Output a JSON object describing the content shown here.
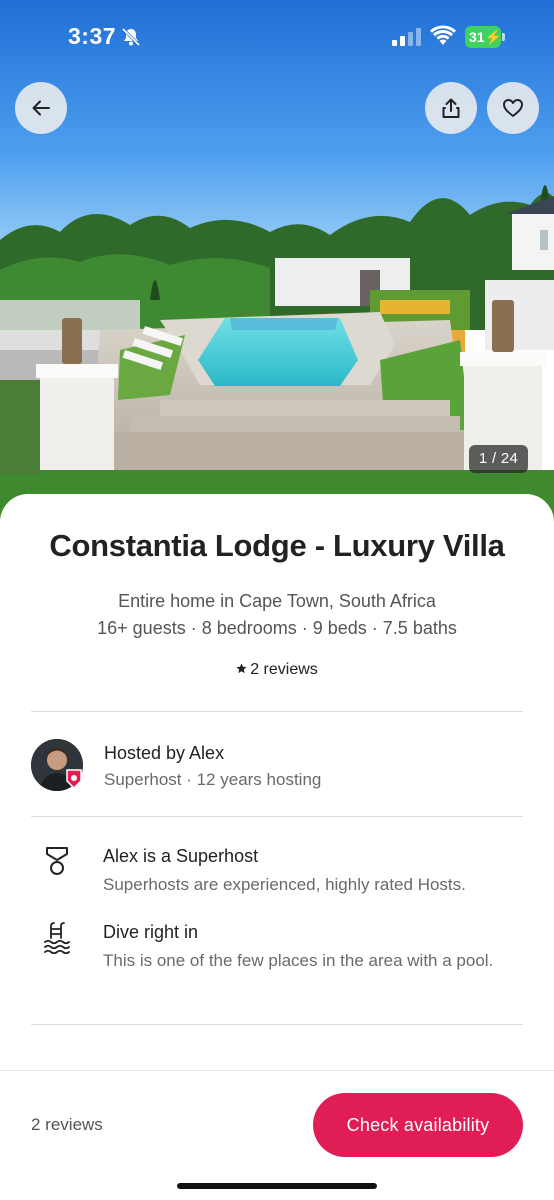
{
  "status_bar": {
    "time": "3:37",
    "battery": "31",
    "icons": [
      "bell-slash-icon",
      "cellular-signal-icon",
      "wifi-icon",
      "battery-charging-icon"
    ]
  },
  "gallery": {
    "counter": "1 / 24",
    "controls": [
      "back-arrow-icon",
      "share-icon",
      "heart-icon"
    ]
  },
  "listing": {
    "title": "Constantia Lodge - Luxury Villa",
    "subtitle": "Entire home in Cape Town, South Africa",
    "details": "16+ guests · 8 bedrooms · 9 beds · 7.5 baths",
    "reviews": "2 reviews"
  },
  "host": {
    "name": "Hosted by Alex",
    "meta": "Superhost · 12 years hosting"
  },
  "highlights": [
    {
      "icon": "superhost-medal-icon",
      "title": "Alex is a Superhost",
      "text": "Superhosts are experienced, highly rated Hosts."
    },
    {
      "icon": "pool-icon",
      "title": "Dive right in",
      "text": "This is one of the few places in the area with a pool."
    }
  ],
  "footer": {
    "reviews": "2 reviews",
    "cta": "Check availability"
  },
  "colors": {
    "brand": "#e01e55",
    "battery": "#3fd35d",
    "text_primary": "#222222",
    "text_secondary": "#6a6a6a"
  }
}
